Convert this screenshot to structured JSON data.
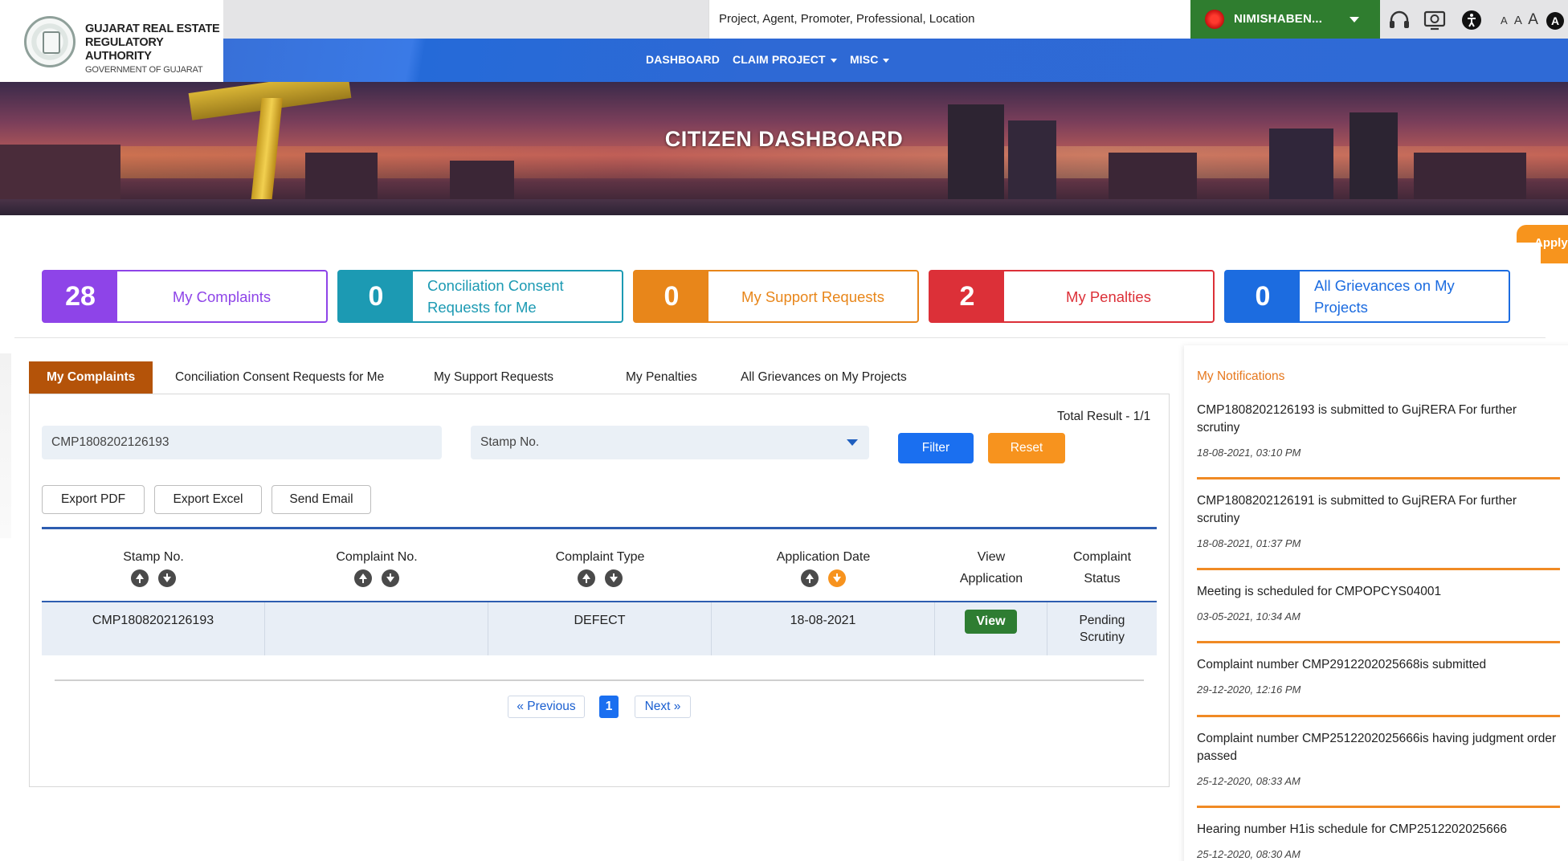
{
  "header": {
    "org_line1": "GUJARAT REAL ESTATE",
    "org_line2": "REGULATORY AUTHORITY",
    "org_line3": "GOVERNMENT OF GUJARAT",
    "search_placeholder": "Project, Agent, Promoter, Professional, Location",
    "user_name": "NIMISHABEN...",
    "font_small": "A",
    "font_medium": "A",
    "font_large": "A",
    "contrast_label": "A",
    "icons": [
      "search-icon",
      "headset-icon",
      "screen-reader-icon",
      "accessibility-icon"
    ]
  },
  "nav": {
    "items": [
      "DASHBOARD",
      "CLAIM PROJECT",
      "MISC"
    ]
  },
  "banner": {
    "title": "CITIZEN DASHBOARD",
    "apply_label": "Apply"
  },
  "cards": [
    {
      "count": "28",
      "label": "My Complaints",
      "color": "#8e44e8"
    },
    {
      "count": "0",
      "label": "Conciliation Consent Requests for Me",
      "color": "#1c9ab3"
    },
    {
      "count": "0",
      "label": "My Support Requests",
      "color": "#e8861a"
    },
    {
      "count": "2",
      "label": "My Penalties",
      "color": "#dc3038"
    },
    {
      "count": "0",
      "label": "All Grievances on My Projects",
      "color": "#1c6ce0"
    }
  ],
  "tabs": [
    "My Complaints",
    "Conciliation Consent Requests for Me",
    "My Support Requests",
    "My Penalties",
    "All Grievances on My Projects"
  ],
  "filters": {
    "search_value": "CMP1808202126193",
    "select_value": "Stamp No.",
    "filter_label": "Filter",
    "reset_label": "Reset",
    "total_result": "Total Result - 1/1",
    "export_pdf": "Export PDF",
    "export_excel": "Export Excel",
    "send_email": "Send Email"
  },
  "table": {
    "headers": [
      "Stamp No.",
      "Complaint No.",
      "Complaint Type",
      "Application Date",
      "View Application",
      "Complaint Status"
    ],
    "header_view_line1": "View",
    "header_view_line2": "Application",
    "header_status_line1": "Complaint",
    "header_status_line2": "Status",
    "rows": [
      {
        "stamp_no": "CMP1808202126193",
        "complaint_no": "",
        "type": "DEFECT",
        "date": "18-08-2021",
        "view": "View",
        "status_line1": "Pending",
        "status_line2": "Scrutiny"
      }
    ]
  },
  "pagination": {
    "previous": "« Previous",
    "current": "1",
    "next": "Next »"
  },
  "notifications": {
    "title": "My Notifications",
    "items": [
      {
        "text": "CMP1808202126193 is submitted to GujRERA For further scrutiny",
        "date": "18-08-2021, 03:10 PM"
      },
      {
        "text": "CMP1808202126191 is submitted to GujRERA For further scrutiny",
        "date": "18-08-2021, 01:37 PM"
      },
      {
        "text": "Meeting is scheduled for CMPOPCYS04001",
        "date": "03-05-2021, 10:34 AM"
      },
      {
        "text": "Complaint number CMP2912202025668is submitted",
        "date": "29-12-2020, 12:16 PM"
      },
      {
        "text": "Complaint number CMP2512202025666is having judgment order passed",
        "date": "25-12-2020, 08:33 AM"
      },
      {
        "text": "Hearing number H1is schedule for CMP2512202025666",
        "date": "25-12-2020, 08:30 AM"
      }
    ]
  },
  "colors": {
    "nav_blue": "#2f6ad6",
    "user_green": "#2f7d2f",
    "active_tab": "#b45309",
    "accent_orange": "#f7931e",
    "filter_blue": "#1a6ff0"
  }
}
